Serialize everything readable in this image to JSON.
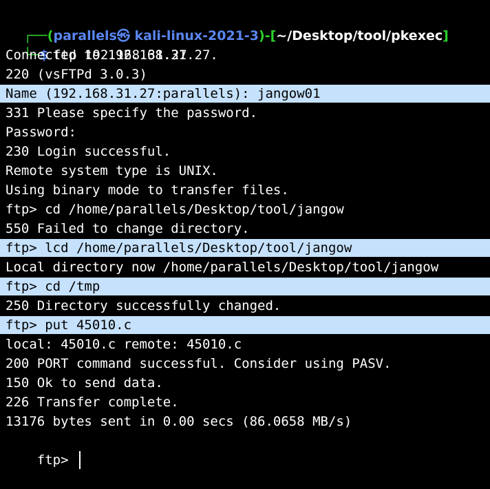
{
  "prompt": {
    "corner_top": "┌──(",
    "user_host": "parallels㉿ kali-linux-2021-3",
    "bracket_mid": ")-[",
    "path": "~/Desktop/tool/pkexec",
    "bracket_end": "]",
    "corner_bottom": "└─",
    "dollar": "$",
    "command_name": "ftp",
    "command_args": " 192.168.31.27"
  },
  "lines": [
    {
      "text": "Connected to 192.168.31.27.",
      "highlighted": false
    },
    {
      "text": "220 (vsFTPd 3.0.3)",
      "highlighted": false
    },
    {
      "text": "Name (192.168.31.27:parallels): jangow01",
      "highlighted": true
    },
    {
      "text": "331 Please specify the password.",
      "highlighted": false
    },
    {
      "text": "Password:",
      "highlighted": false
    },
    {
      "text": "230 Login successful.",
      "highlighted": false
    },
    {
      "text": "Remote system type is UNIX.",
      "highlighted": false
    },
    {
      "text": "Using binary mode to transfer files.",
      "highlighted": false
    },
    {
      "text": "ftp> cd /home/parallels/Desktop/tool/jangow",
      "highlighted": false
    },
    {
      "text": "550 Failed to change directory.",
      "highlighted": false
    },
    {
      "text": "ftp> lcd /home/parallels/Desktop/tool/jangow",
      "highlighted": true
    },
    {
      "text": "Local directory now /home/parallels/Desktop/tool/jangow",
      "highlighted": false
    },
    {
      "text": "ftp> cd /tmp",
      "highlighted": true
    },
    {
      "text": "250 Directory successfully changed.",
      "highlighted": false
    },
    {
      "text": "ftp> put 45010.c",
      "highlighted": true
    },
    {
      "text": "local: 45010.c remote: 45010.c",
      "highlighted": false
    },
    {
      "text": "200 PORT command successful. Consider using PASV.",
      "highlighted": false
    },
    {
      "text": "150 Ok to send data.",
      "highlighted": false
    },
    {
      "text": "226 Transfer complete.",
      "highlighted": false
    },
    {
      "text": "13176 bytes sent in 0.00 secs (86.0658 MB/s)",
      "highlighted": false
    }
  ],
  "final_prompt": "ftp> ",
  "colors": {
    "background": "#000000",
    "text": "#ffffff",
    "prompt_green": "#2fd12f",
    "prompt_blue": "#5a86f0",
    "highlight": "#c5e1fb"
  }
}
